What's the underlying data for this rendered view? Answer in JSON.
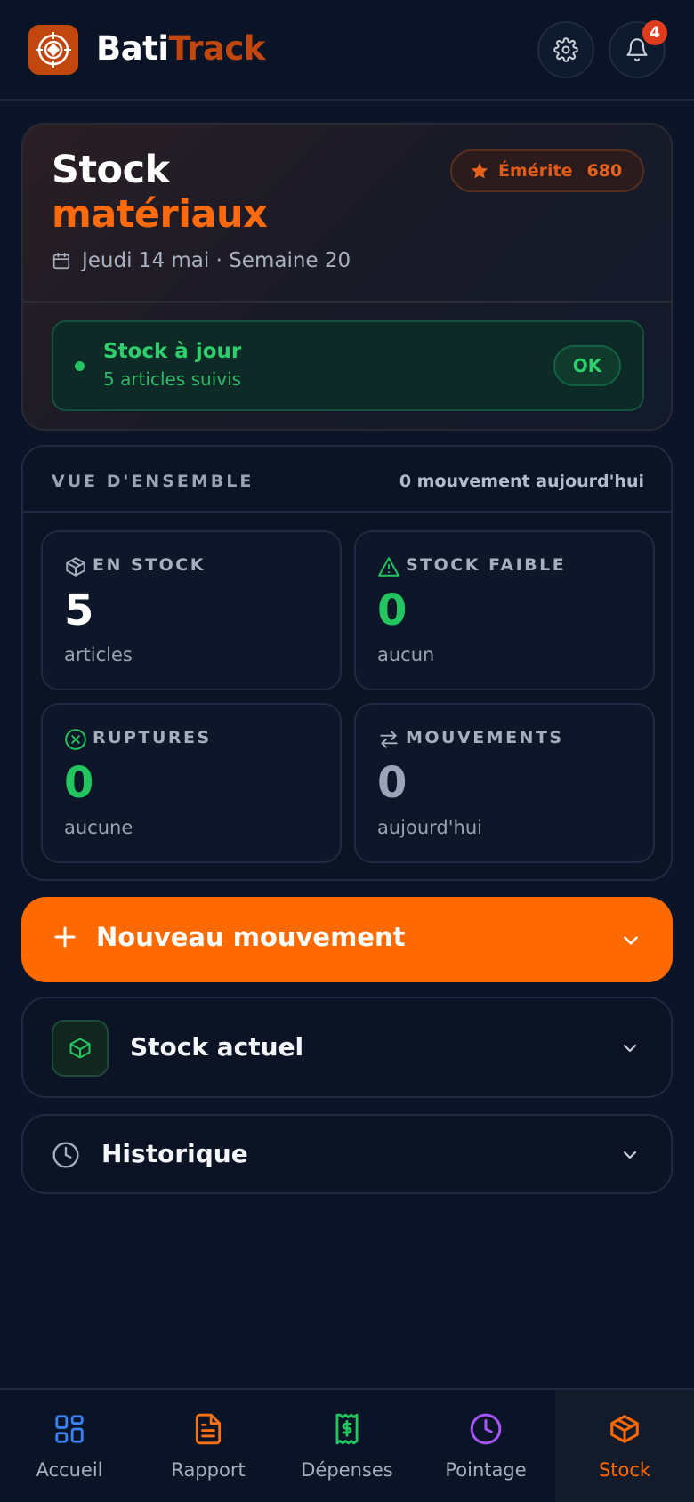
{
  "app": {
    "brand_part1": "Bati",
    "brand_part2": "Track",
    "notifications_count": "4"
  },
  "hero": {
    "title_line1": "Stock",
    "title_line2": "matériaux",
    "rank_label": "Émérite",
    "rank_points": "680",
    "date": "Jeudi 14 mai · Semaine 20",
    "status_title": "Stock à jour",
    "status_subtitle": "5 articles suivis",
    "status_pill": "OK"
  },
  "overview": {
    "title": "VUE D'ENSEMBLE",
    "movements_today": "0 mouvement aujourd'hui",
    "tiles": [
      {
        "label": "EN STOCK",
        "value": "5",
        "sub": "articles",
        "icon": "box-icon",
        "value_color": "#ffffff"
      },
      {
        "label": "STOCK FAIBLE",
        "value": "0",
        "sub": "aucun",
        "icon": "warning-triangle-icon",
        "value_color": "#22c55e"
      },
      {
        "label": "RUPTURES",
        "value": "0",
        "sub": "aucune",
        "icon": "x-circle-icon",
        "value_color": "#22c55e"
      },
      {
        "label": "MOUVEMENTS",
        "value": "0",
        "sub": "aujourd'hui",
        "icon": "arrows-swap-icon",
        "value_color": "#9aa6b8"
      }
    ]
  },
  "actions": {
    "new_movement": "Nouveau mouvement",
    "current_stock": "Stock actuel",
    "history": "Historique"
  },
  "nav": [
    {
      "label": "Accueil",
      "icon": "grid-icon",
      "color": "#3b82f6"
    },
    {
      "label": "Rapport",
      "icon": "document-icon",
      "color": "#f97316"
    },
    {
      "label": "Dépenses",
      "icon": "receipt-dollar-icon",
      "color": "#22c55e"
    },
    {
      "label": "Pointage",
      "icon": "clock-icon",
      "color": "#a855f7"
    },
    {
      "label": "Stock",
      "icon": "box-icon",
      "color": "#ff6a00",
      "active": true
    }
  ],
  "colors": {
    "accent": "#ff6a00",
    "brand": "#c2470f",
    "success": "#22c55e",
    "background": "#0c1527"
  }
}
